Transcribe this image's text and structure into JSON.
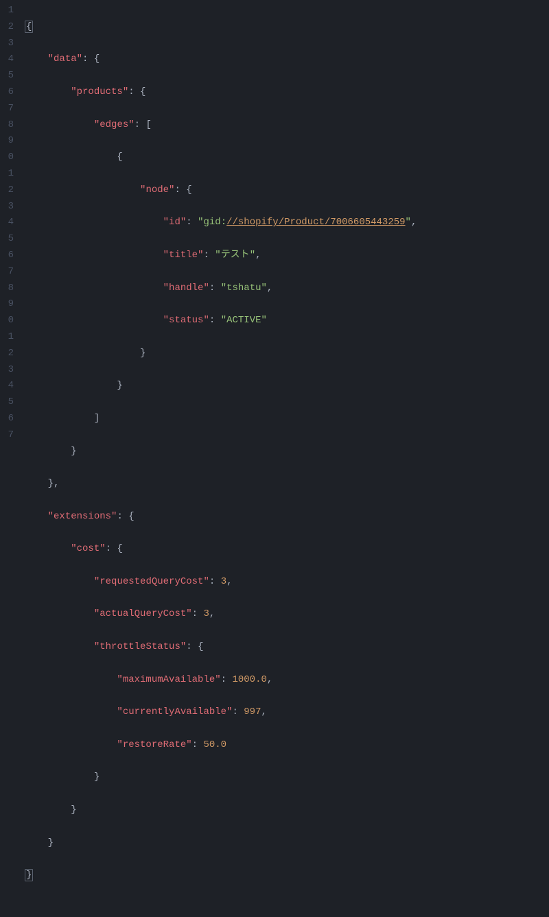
{
  "lineNumbers": [
    "1",
    "2",
    "3",
    "4",
    "5",
    "6",
    "7",
    "8",
    "9",
    "0",
    "1",
    "2",
    "3",
    "4",
    "5",
    "6",
    "7",
    "8",
    "9",
    "0",
    "1",
    "2",
    "3",
    "4",
    "5",
    "6",
    "7"
  ],
  "json": {
    "data_key": "data",
    "products_key": "products",
    "edges_key": "edges",
    "node_key": "node",
    "id_key": "id",
    "id_prefix": "gid:",
    "id_link": "//shopify/Product/7006605443259",
    "title_key": "title",
    "title_val": "テスト",
    "handle_key": "handle",
    "handle_val": "tshatu",
    "status_key": "status",
    "status_val": "ACTIVE",
    "extensions_key": "extensions",
    "cost_key": "cost",
    "requestedQueryCost_key": "requestedQueryCost",
    "requestedQueryCost_val": "3",
    "actualQueryCost_key": "actualQueryCost",
    "actualQueryCost_val": "3",
    "throttleStatus_key": "throttleStatus",
    "maximumAvailable_key": "maximumAvailable",
    "maximumAvailable_val": "1000.0",
    "currentlyAvailable_key": "currentlyAvailable",
    "currentlyAvailable_val": "997",
    "restoreRate_key": "restoreRate",
    "restoreRate_val": "50.0"
  }
}
